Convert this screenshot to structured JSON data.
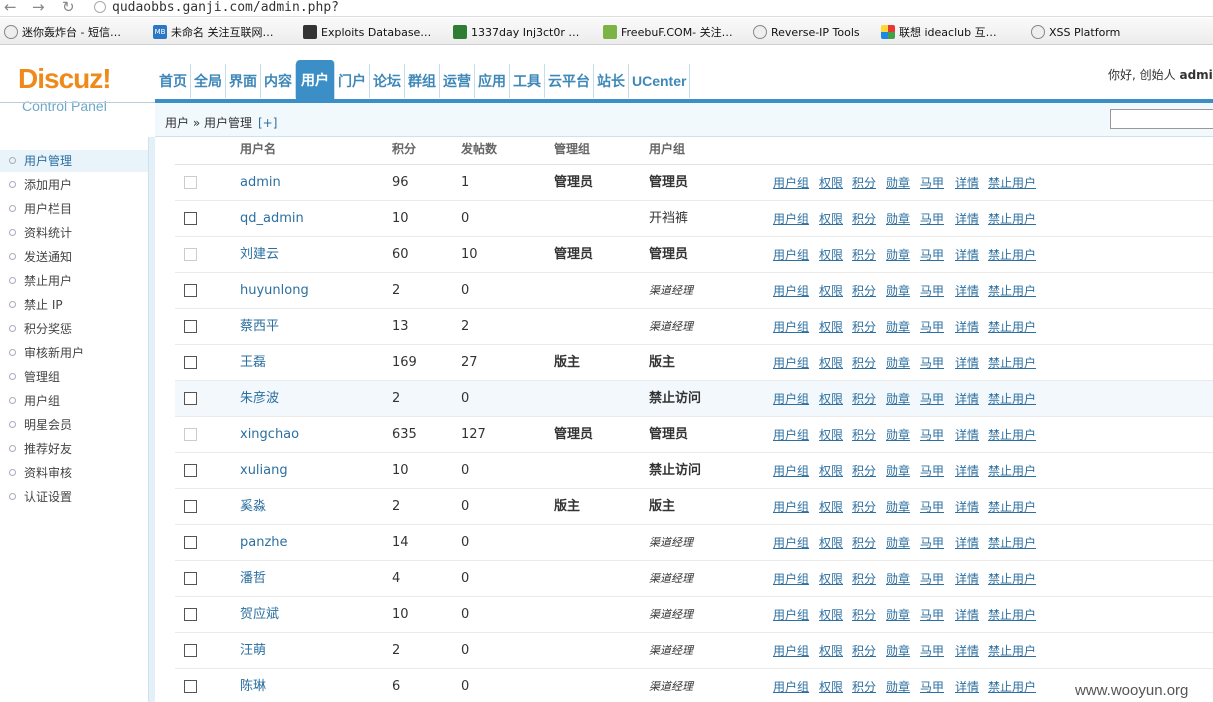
{
  "browser": {
    "url": "qudaobbs.ganji.com/admin.php?",
    "bookmarks": [
      {
        "label": "迷你轰炸台 - 短信…",
        "icon": "globe-icon"
      },
      {
        "label": "未命名 关注互联网…",
        "icon": "mb-icon"
      },
      {
        "label": "Exploits Database…",
        "icon": "exploit-db-icon"
      },
      {
        "label": "1337day Inj3ct0r …",
        "icon": "1337day-icon"
      },
      {
        "label": "FreebuF.COM- 关注…",
        "icon": "freebuf-icon"
      },
      {
        "label": "Reverse-IP Tools",
        "icon": "globe-icon"
      },
      {
        "label": "联想 ideaclub 互…",
        "icon": "lenovo-icon"
      },
      {
        "label": "XSS Platform",
        "icon": "globe-icon"
      }
    ]
  },
  "header": {
    "logo_text": "Discuz!",
    "logo_sub": "Control Panel",
    "greeting": "你好, 创始人",
    "username": "admi",
    "tabs": [
      "首页",
      "全局",
      "界面",
      "内容",
      "用户",
      "门户",
      "论坛",
      "群组",
      "运营",
      "应用",
      "工具",
      "云平台",
      "站长",
      "UCenter"
    ],
    "active_tab": "用户"
  },
  "breadcrumb": {
    "path": "用户 » 用户管理",
    "expand": "[+]"
  },
  "sidebar": {
    "items": [
      "用户管理",
      "添加用户",
      "用户栏目",
      "资料统计",
      "发送通知",
      "禁止用户",
      "禁止 IP",
      "积分奖惩",
      "审核新用户",
      "管理组",
      "用户组",
      "明星会员",
      "推荐好友",
      "资料审核",
      "认证设置"
    ],
    "active": "用户管理"
  },
  "table": {
    "columns": [
      "用户名",
      "积分",
      "发帖数",
      "管理组",
      "用户组"
    ],
    "actions": [
      "用户组",
      "权限",
      "积分",
      "勋章",
      "马甲",
      "详情",
      "禁止用户"
    ],
    "rows": [
      {
        "name": "admin",
        "credits": "96",
        "posts": "1",
        "admin_group": "管理员",
        "user_group": "管理员",
        "style": "bold",
        "checkbox_disabled": true,
        "highlight": false
      },
      {
        "name": "qd_admin",
        "credits": "10",
        "posts": "0",
        "admin_group": "",
        "user_group": "开裆裤",
        "style": "plain",
        "checkbox_disabled": false,
        "highlight": false
      },
      {
        "name": "刘建云",
        "credits": "60",
        "posts": "10",
        "admin_group": "管理员",
        "user_group": "管理员",
        "style": "bold",
        "checkbox_disabled": true,
        "highlight": false
      },
      {
        "name": "huyunlong",
        "credits": "2",
        "posts": "0",
        "admin_group": "",
        "user_group": "渠道经理",
        "style": "italic",
        "checkbox_disabled": false,
        "highlight": false
      },
      {
        "name": "蔡西平",
        "credits": "13",
        "posts": "2",
        "admin_group": "",
        "user_group": "渠道经理",
        "style": "italic",
        "checkbox_disabled": false,
        "highlight": false
      },
      {
        "name": "王磊",
        "credits": "169",
        "posts": "27",
        "admin_group": "版主",
        "user_group": "版主",
        "style": "bold",
        "checkbox_disabled": false,
        "highlight": false
      },
      {
        "name": "朱彦波",
        "credits": "2",
        "posts": "0",
        "admin_group": "",
        "user_group": "禁止访问",
        "style": "bold",
        "checkbox_disabled": false,
        "highlight": true
      },
      {
        "name": "xingchao",
        "credits": "635",
        "posts": "127",
        "admin_group": "管理员",
        "user_group": "管理员",
        "style": "bold",
        "checkbox_disabled": true,
        "highlight": false
      },
      {
        "name": "xuliang",
        "credits": "10",
        "posts": "0",
        "admin_group": "",
        "user_group": "禁止访问",
        "style": "bold",
        "checkbox_disabled": false,
        "highlight": false
      },
      {
        "name": "奚淼",
        "credits": "2",
        "posts": "0",
        "admin_group": "版主",
        "user_group": "版主",
        "style": "bold",
        "checkbox_disabled": false,
        "highlight": false
      },
      {
        "name": "panzhe",
        "credits": "14",
        "posts": "0",
        "admin_group": "",
        "user_group": "渠道经理",
        "style": "italic",
        "checkbox_disabled": false,
        "highlight": false
      },
      {
        "name": "潘哲",
        "credits": "4",
        "posts": "0",
        "admin_group": "",
        "user_group": "渠道经理",
        "style": "italic",
        "checkbox_disabled": false,
        "highlight": false
      },
      {
        "name": "贺应斌",
        "credits": "10",
        "posts": "0",
        "admin_group": "",
        "user_group": "渠道经理",
        "style": "italic",
        "checkbox_disabled": false,
        "highlight": false
      },
      {
        "name": "汪萌",
        "credits": "2",
        "posts": "0",
        "admin_group": "",
        "user_group": "渠道经理",
        "style": "italic",
        "checkbox_disabled": false,
        "highlight": false
      },
      {
        "name": "陈琳",
        "credits": "6",
        "posts": "0",
        "admin_group": "",
        "user_group": "渠道经理",
        "style": "italic",
        "checkbox_disabled": false,
        "highlight": false
      }
    ]
  },
  "watermark": "www.wooyun.org",
  "colors": {
    "accent": "#3b8fc6",
    "link": "#2c6fa0",
    "logo": "#ef8a1a"
  }
}
